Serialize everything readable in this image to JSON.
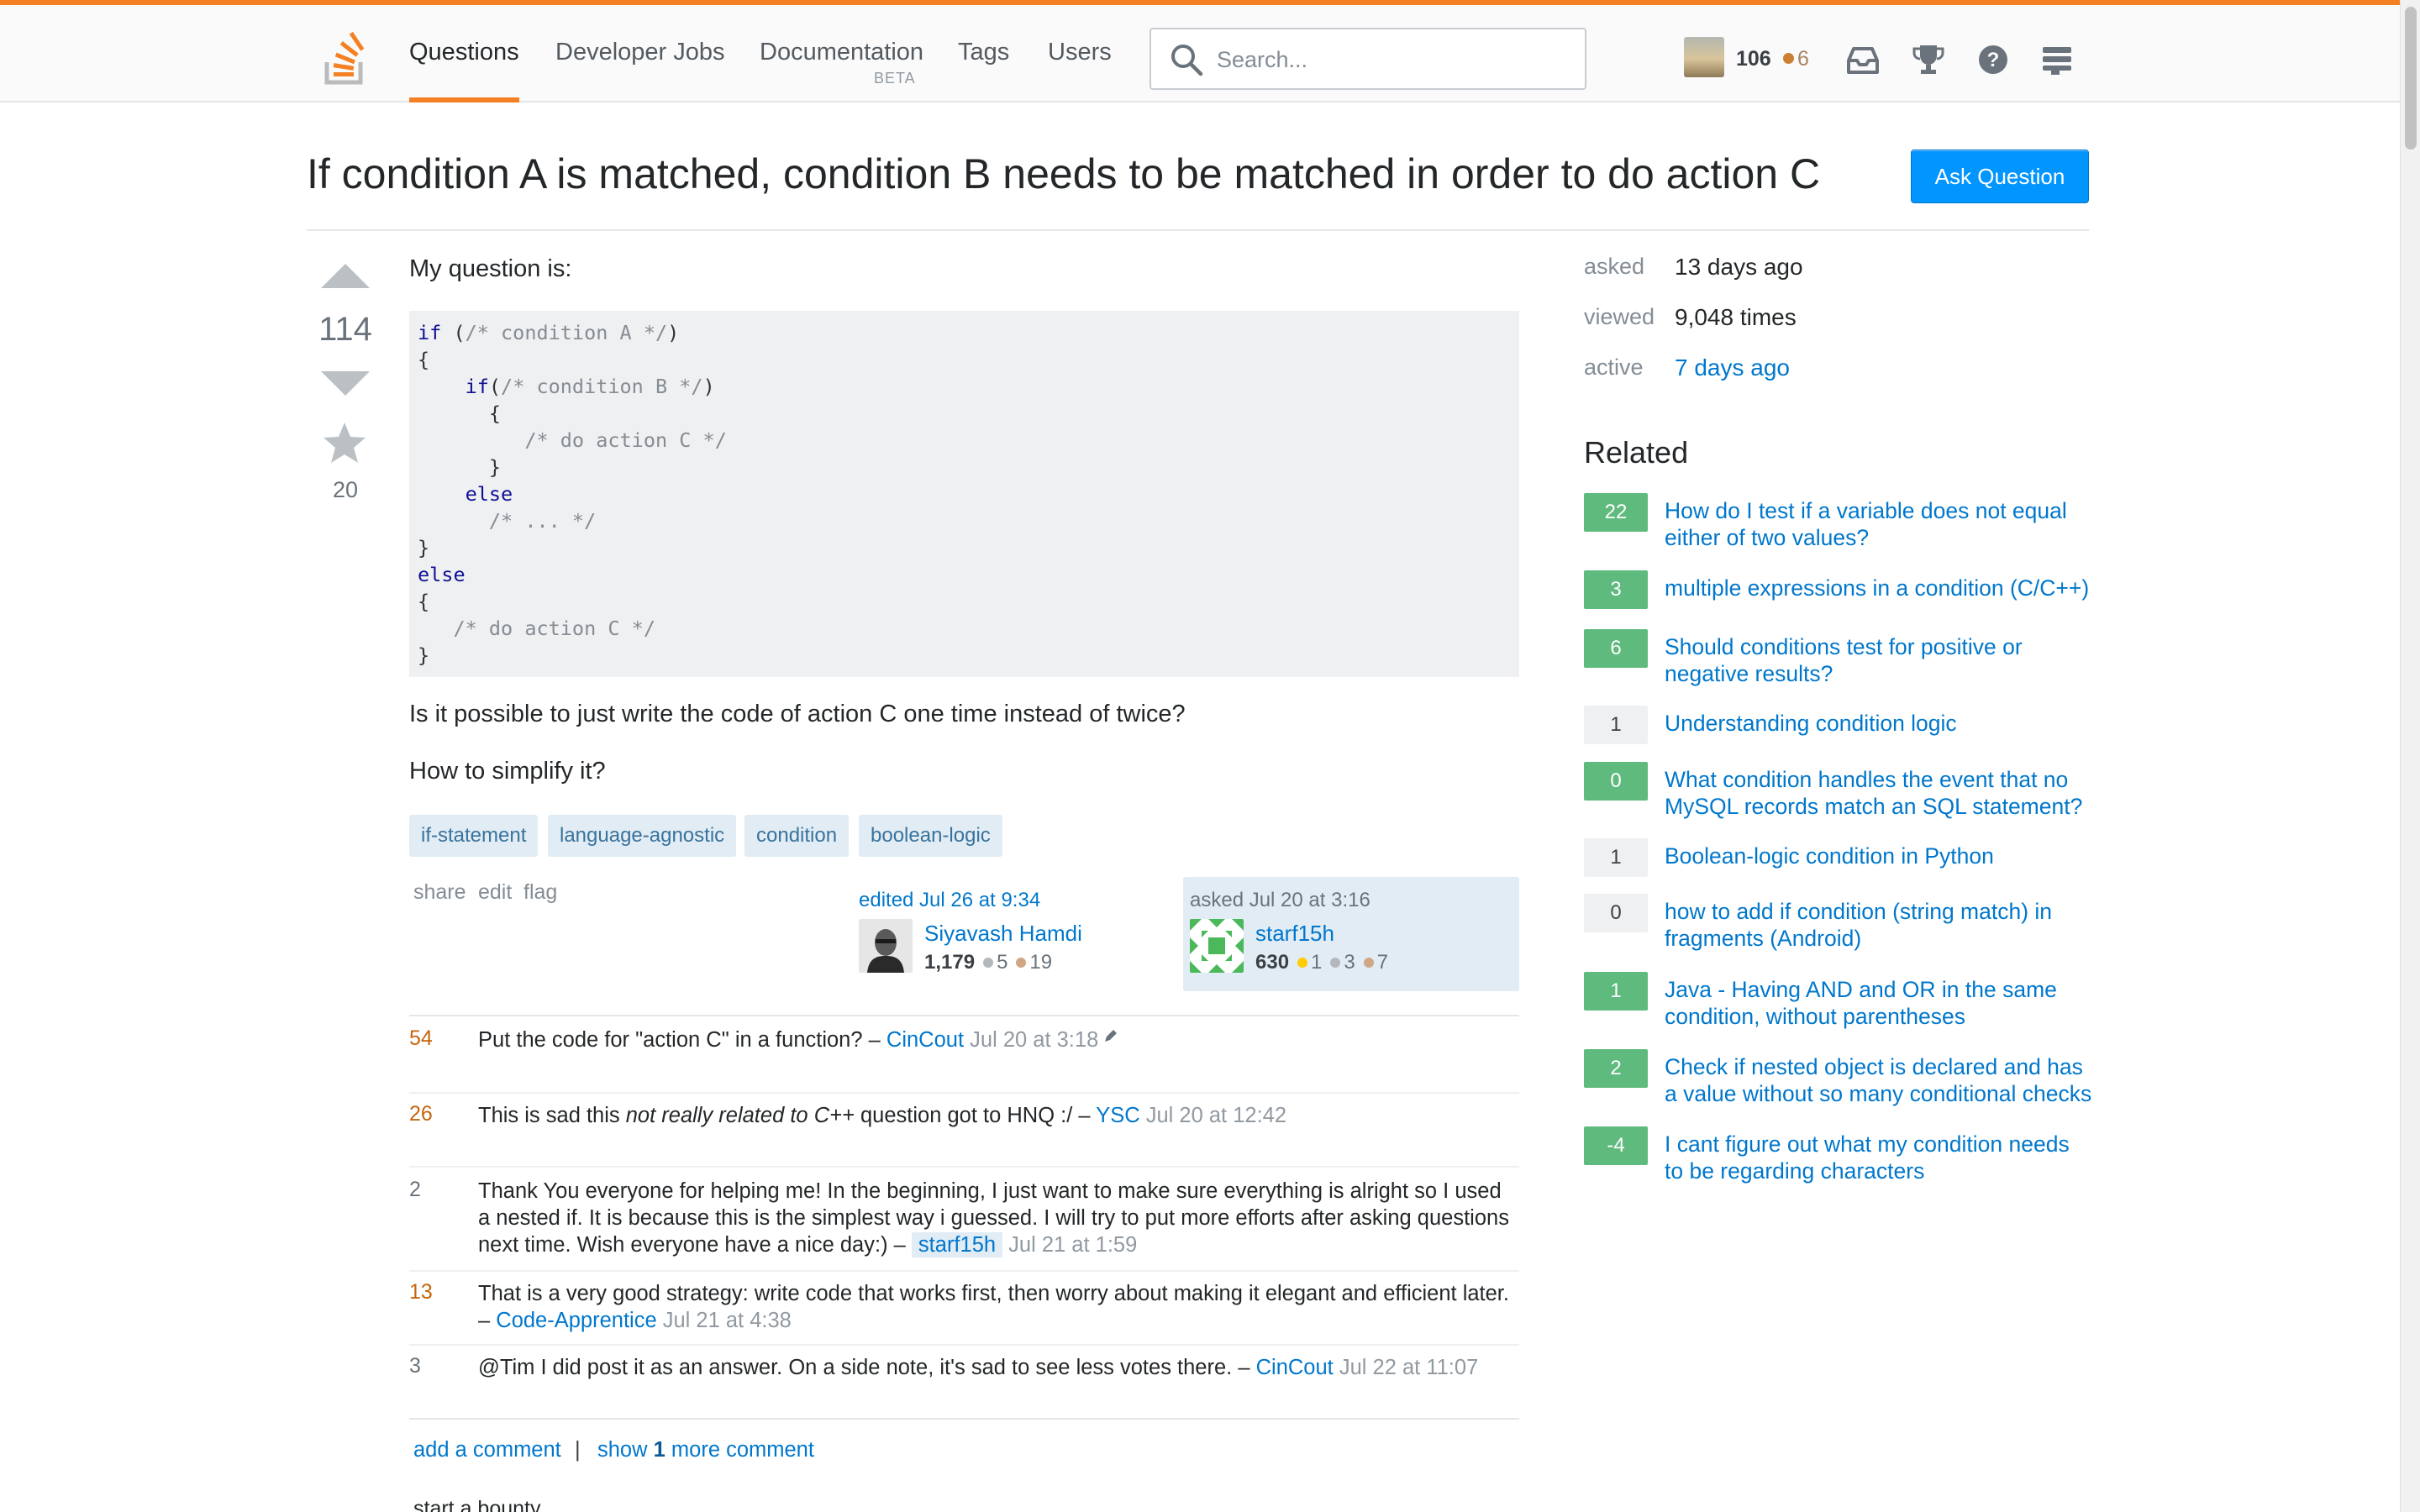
{
  "nav": {
    "items": [
      "Questions",
      "Developer Jobs",
      "Documentation",
      "Tags",
      "Users"
    ],
    "documentation_badge": "BETA",
    "search_placeholder": "Search...",
    "reputation": "106",
    "bronze_badges": "6"
  },
  "question": {
    "title": "If condition A is matched, condition B needs to be matched in order to do action C",
    "ask_button": "Ask Question",
    "votes": "114",
    "favorites": "20",
    "intro": "My question is:",
    "code": {
      "l1_kw": "if",
      "l1_a": " (",
      "l1_cm": "/* condition A */",
      "l1_b": ")",
      "l2": "{",
      "l3_kw": "    if",
      "l3_a": "(",
      "l3_cm": "/* condition B */",
      "l3_b": ")",
      "l4": "      {",
      "l5_cm": "         /* do action C */",
      "l6": "      }",
      "l7_kw": "    else",
      "l8_cm": "      /* ... */",
      "l9": "}",
      "l10_kw": "else",
      "l11": "{",
      "l12_cm": "   /* do action C */",
      "l13": "}"
    },
    "p2": "Is it possible to just write the code of action C one time instead of twice?",
    "p3": "How to simplify it?",
    "tags": [
      "if-statement",
      "language-agnostic",
      "condition",
      "boolean-logic"
    ],
    "menu": [
      "share",
      "edit",
      "flag"
    ],
    "editor": {
      "action": "edited Jul 26 at 9:34",
      "name": "Siyavash Hamdi",
      "rep": "1,179",
      "silver": "5",
      "bronze": "19"
    },
    "owner": {
      "action": "asked Jul 20 at 3:16",
      "name": "starf15h",
      "rep": "630",
      "gold": "1",
      "silver": "3",
      "bronze": "7"
    }
  },
  "comments": [
    {
      "score": "54",
      "text": "Put the code for \"action C\" in a function? – ",
      "user": "CinCout",
      "date": "Jul 20 at 3:18"
    },
    {
      "score": "26",
      "text_a": "This is sad this ",
      "text_em": "not really related to C++",
      "text_b": " question got to HNQ :/ – ",
      "user": "YSC",
      "date": "Jul 20 at 12:42"
    },
    {
      "score": "2",
      "text": "Thank You everyone for helping me! In the beginning, I just want to make sure everything is alright so I used a nested if. It is because this is the simplest way i guessed. I will try to put more efforts after asking questions next time. Wish everyone have a nice day:) – ",
      "user": "starf15h",
      "date": "Jul 21 at 1:59"
    },
    {
      "score": "13",
      "text": "That is a very good strategy: write code that works first, then worry about making it elegant and efficient later. – ",
      "user": "Code-Apprentice",
      "date": "Jul 21 at 4:38"
    },
    {
      "score": "3",
      "text": "@Tim I did post it as an answer. On a side note, it's sad to see less votes there. – ",
      "user": "CinCout",
      "date": "Jul 22 at 11:07"
    }
  ],
  "comment_links": {
    "add": "add a comment",
    "separator": "|",
    "show_a": "show ",
    "show_count": "1",
    "show_b": " more comment",
    "bounty": "start a bounty"
  },
  "sidebar": {
    "meta": [
      {
        "label": "asked",
        "value": "13 days ago"
      },
      {
        "label": "viewed",
        "value": "9,048 times"
      },
      {
        "label": "active",
        "value": "7 days ago"
      }
    ],
    "related_heading": "Related",
    "related": [
      {
        "score": "22",
        "title": "How do I test if a variable does not equal either of two values?"
      },
      {
        "score": "3",
        "title": "multiple expressions in a condition (C/C++)"
      },
      {
        "score": "6",
        "title": "Should conditions test for positive or negative results?"
      },
      {
        "score": "1",
        "title": "Understanding condition logic"
      },
      {
        "score": "0",
        "title": "What condition handles the event that no MySQL records match an SQL statement?"
      },
      {
        "score": "1",
        "title": "Boolean-logic condition in Python"
      },
      {
        "score": "0",
        "title": "how to add if condition (string match) in fragments (Android)"
      },
      {
        "score": "1",
        "title": "Java - Having AND and OR in the same condition, without parentheses"
      },
      {
        "score": "2",
        "title": "Check if nested object is declared and has a value without so many conditional checks"
      },
      {
        "score": "-4",
        "title": "I cant figure out what my condition needs to be regarding characters"
      }
    ]
  },
  "colors": {
    "accent": "#f48024",
    "link": "#0077cc",
    "button": "#0095ff",
    "answered": "#5fba7d",
    "tag_bg": "#e1ecf4"
  }
}
